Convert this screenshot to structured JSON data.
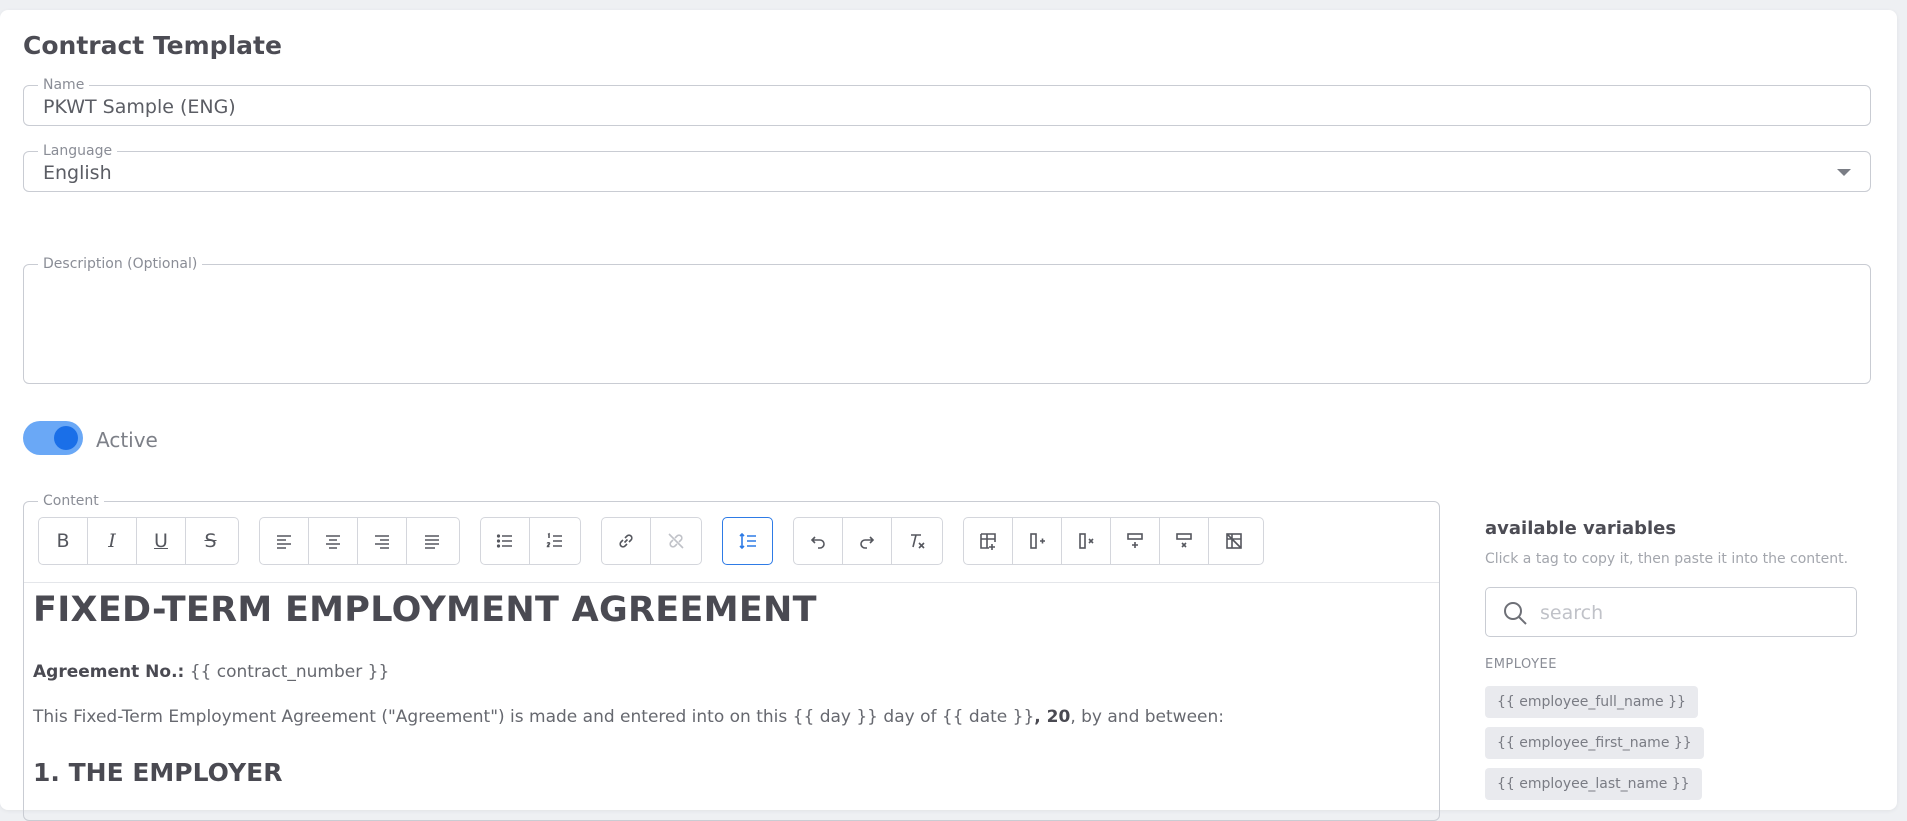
{
  "page": {
    "title": "Contract Template"
  },
  "fields": {
    "name": {
      "label": "Name",
      "value": "PKWT Sample (ENG)"
    },
    "language": {
      "label": "Language",
      "value": "English"
    },
    "description": {
      "label": "Description (Optional)",
      "value": ""
    }
  },
  "active": {
    "label": "Active",
    "on": true
  },
  "content": {
    "label": "Content",
    "document": {
      "title": "FIXED-TERM EMPLOYMENT AGREEMENT",
      "agreement_label": "Agreement No.:",
      "agreement_value": "{{ contract_number }}",
      "intro_part1": "This Fixed-Term Employment Agreement (\"Agreement\") is made and entered into on this {{ day }} day of {{ date }}",
      "intro_bold": ", 20",
      "intro_part2": ", by and between:",
      "section1": "1. THE EMPLOYER"
    }
  },
  "toolbar": {
    "icons": [
      "bold-icon",
      "italic-icon",
      "underline-icon",
      "strikethrough-icon",
      "align-left-icon",
      "align-center-icon",
      "align-right-icon",
      "align-justify-icon",
      "bullet-list-icon",
      "numbered-list-icon",
      "link-icon",
      "unlink-icon",
      "line-height-icon",
      "undo-icon",
      "redo-icon",
      "clear-format-icon",
      "insert-table-icon",
      "add-column-icon",
      "delete-column-icon",
      "add-row-icon",
      "delete-row-icon",
      "delete-table-icon"
    ],
    "bold_glyph": "B",
    "italic_glyph": "I",
    "underline_glyph": "U",
    "strike_glyph": "S"
  },
  "variables": {
    "title": "available variables",
    "hint": "Click a tag to copy it, then paste it into the content.",
    "search_placeholder": "search",
    "sections": [
      {
        "label": "EMPLOYEE",
        "tags": [
          "{{ employee_full_name }}",
          "{{ employee_first_name }}",
          "{{ employee_last_name }}"
        ]
      }
    ]
  },
  "colors": {
    "accent": "#2e7be6",
    "toggle_track": "#6aa8f6",
    "toggle_knob": "#1a6fe8"
  }
}
